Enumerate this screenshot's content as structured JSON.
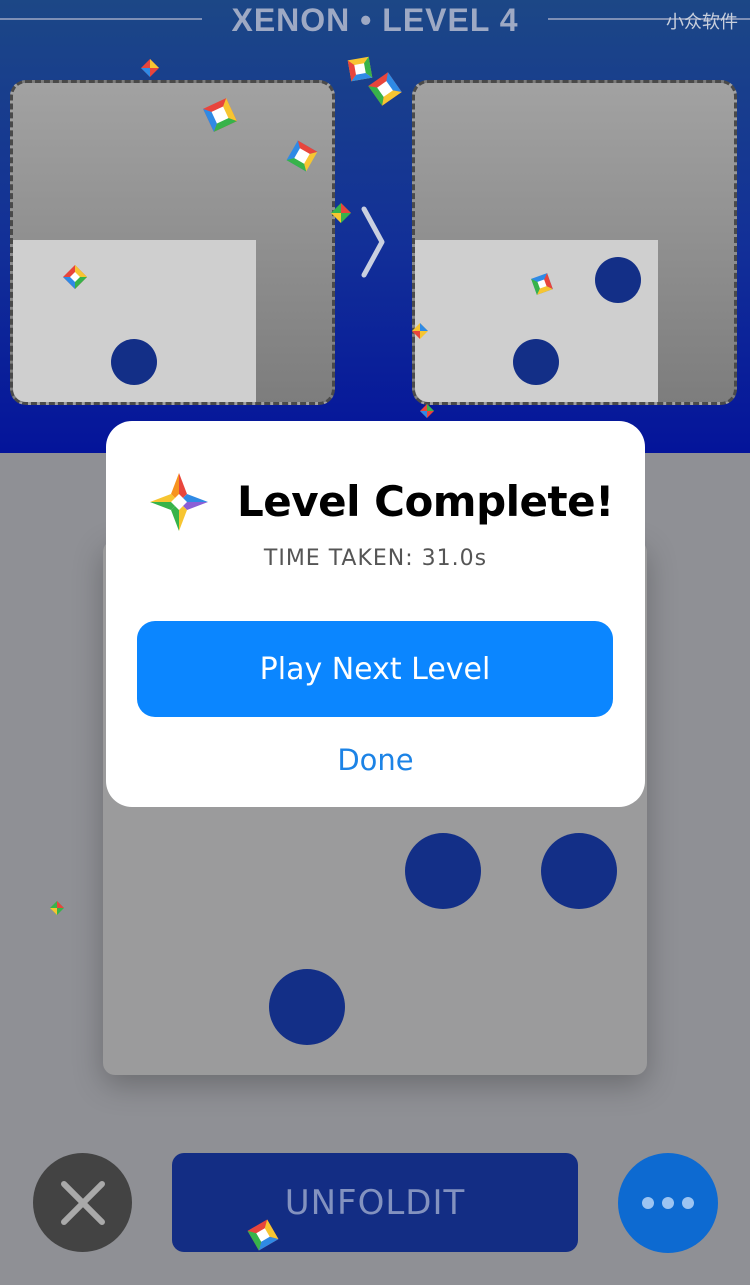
{
  "header": {
    "title": "XENON  •  LEVEL 4",
    "watermark": "小众软件"
  },
  "dialog": {
    "logo_icon": "four-color-star-logo-icon",
    "title": "Level Complete!",
    "time_taken": "TIME TAKEN: 31.0s",
    "primary_label": "Play Next Level",
    "secondary_label": "Done"
  },
  "controls": {
    "close_icon": "close-x-icon",
    "main_label": "UNFOLDIT",
    "more_icon": "ellipsis-icon"
  },
  "icons": {
    "arrow": "chevron-right-icon",
    "confetti": "confetti-icon"
  },
  "colors": {
    "accent_blue": "#0b86ff",
    "dot_blue": "#132f87",
    "header_blue": "#122f98",
    "button_navy": "#132d84"
  }
}
